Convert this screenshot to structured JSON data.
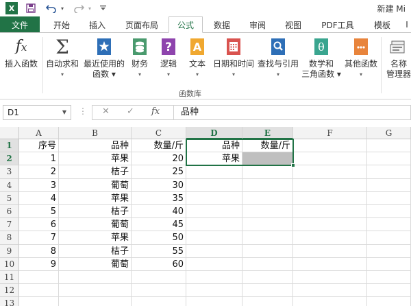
{
  "titlebar": {
    "logo_text": "X",
    "title": "新建 Mi"
  },
  "tabs": {
    "file": "文件",
    "items": [
      "开始",
      "插入",
      "页面布局",
      "公式",
      "数据",
      "审阅",
      "视图",
      "PDF工具",
      "模板",
      "I"
    ],
    "active": "公式"
  },
  "ribbon": {
    "buttons": [
      {
        "label1": "插入函数",
        "label2": "",
        "icon": "fx-icon"
      },
      {
        "label1": "自动求和",
        "label2": "▾",
        "icon": "sigma-icon"
      },
      {
        "label1": "最近使用的",
        "label2": "函数 ▾",
        "icon": "star-book-icon"
      },
      {
        "label1": "财务",
        "label2": "▾",
        "icon": "coins-book-icon"
      },
      {
        "label1": "逻辑",
        "label2": "▾",
        "icon": "question-book-icon"
      },
      {
        "label1": "文本",
        "label2": "▾",
        "icon": "text-book-icon"
      },
      {
        "label1": "日期和时间",
        "label2": "▾",
        "icon": "calendar-book-icon"
      },
      {
        "label1": "查找与引用",
        "label2": "▾",
        "icon": "magnifier-book-icon"
      },
      {
        "label1": "数学和",
        "label2": "三角函数 ▾",
        "icon": "theta-book-icon"
      },
      {
        "label1": "其他函数",
        "label2": "▾",
        "icon": "more-book-icon"
      },
      {
        "label1": "名称",
        "label2": "管理器",
        "icon": "name-manager-icon"
      }
    ],
    "group_label": "函数库"
  },
  "formula_bar": {
    "name_box": "D1",
    "dots": "⋮",
    "cancel": "✕",
    "enter": "✓",
    "fx": "fx",
    "content": "品种"
  },
  "sheet": {
    "columns": [
      "A",
      "B",
      "C",
      "D",
      "E",
      "F",
      "G"
    ],
    "rows": [
      "1",
      "2",
      "3",
      "4",
      "5",
      "6",
      "7",
      "8",
      "9",
      "10",
      "11",
      "12",
      "13"
    ],
    "cells": [
      [
        "序号",
        "品种",
        "数量/斤",
        "品种",
        "数量/斤",
        "",
        ""
      ],
      [
        "1",
        "苹果",
        "20",
        "苹果",
        "",
        "",
        ""
      ],
      [
        "2",
        "桔子",
        "25",
        "",
        "",
        "",
        ""
      ],
      [
        "3",
        "葡萄",
        "30",
        "",
        "",
        "",
        ""
      ],
      [
        "4",
        "苹果",
        "35",
        "",
        "",
        "",
        ""
      ],
      [
        "5",
        "桔子",
        "40",
        "",
        "",
        "",
        ""
      ],
      [
        "6",
        "葡萄",
        "45",
        "",
        "",
        "",
        ""
      ],
      [
        "7",
        "苹果",
        "50",
        "",
        "",
        "",
        ""
      ],
      [
        "8",
        "桔子",
        "55",
        "",
        "",
        "",
        ""
      ],
      [
        "9",
        "葡萄",
        "60",
        "",
        "",
        "",
        ""
      ],
      [
        "",
        "",
        "",
        "",
        "",
        "",
        ""
      ],
      [
        "",
        "",
        "",
        "",
        "",
        "",
        ""
      ],
      [
        "",
        "",
        "",
        "",
        "",
        "",
        ""
      ]
    ],
    "colors": {
      "accent": "#217346",
      "shade": "#bfbfbf"
    }
  }
}
